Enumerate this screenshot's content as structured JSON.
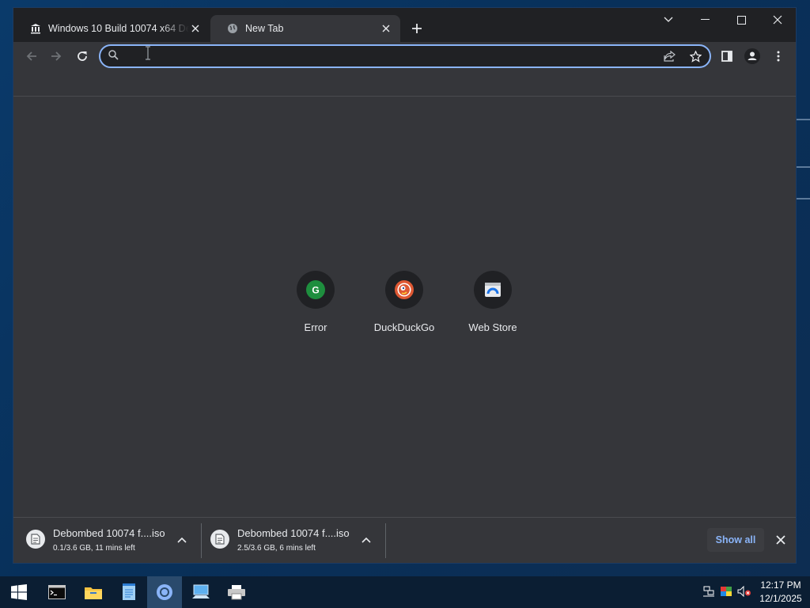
{
  "tabs": [
    {
      "title": "Windows 10 Build 10074 x64 Del",
      "favicon": "library-icon",
      "active": false
    },
    {
      "title": "New Tab",
      "favicon": "globe-icon",
      "active": true
    }
  ],
  "omnibox": {
    "value": "",
    "placeholder": ""
  },
  "shortcuts": [
    {
      "label": "Error",
      "icon": "g-letter-icon",
      "letter": "G",
      "color": "#1e8e3e"
    },
    {
      "label": "DuckDuckGo",
      "icon": "duckduckgo-icon",
      "color": "#de5833"
    },
    {
      "label": "Web Store",
      "icon": "web-store-icon",
      "color": "#1a73e8"
    }
  ],
  "downloads": [
    {
      "name": "Debombed 10074 f....iso",
      "status": "0.1/3.6 GB, 11 mins left"
    },
    {
      "name": "Debombed 10074 f....iso",
      "status": "2.5/3.6 GB, 6 mins left"
    }
  ],
  "downloads_bar": {
    "show_all": "Show all"
  },
  "taskbar": {
    "time": "12:17 PM",
    "date": "12/1/2025",
    "pinned": [
      "start-icon",
      "terminal-icon",
      "file-explorer-icon",
      "notepad-icon",
      "chrome-icon",
      "remote-desktop-icon",
      "printer-icon"
    ]
  },
  "colors": {
    "accent": "#8ab4f8",
    "tab_active": "#35363a",
    "frame": "#202124",
    "taskbar": "#0b1e33"
  }
}
